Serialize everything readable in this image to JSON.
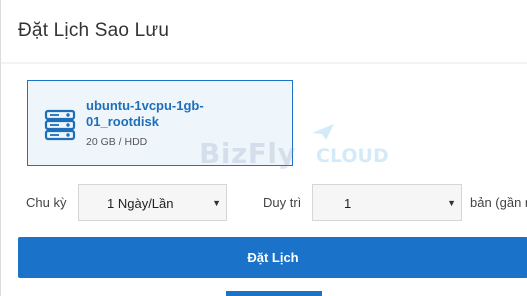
{
  "modal": {
    "title": "Đặt Lịch Sao Lưu"
  },
  "resource": {
    "name": "ubuntu-1vcpu-1gb-01_rootdisk",
    "meta": "20 GB / HDD",
    "icon": "server-icon"
  },
  "watermark": {
    "brand": "BizFly",
    "suffix": "CLOUD"
  },
  "schedule": {
    "cycle_label": "Chu kỳ",
    "cycle_value": "1 Ngày/Lần",
    "retain_label": "Duy trì",
    "retain_value": "1",
    "copies_label": "bản (gần n"
  },
  "actions": {
    "submit_label": "Đặt Lịch"
  },
  "colors": {
    "primary": "#1a73c9",
    "card_bg": "#eef6fc",
    "card_text": "#1f6fb8"
  }
}
